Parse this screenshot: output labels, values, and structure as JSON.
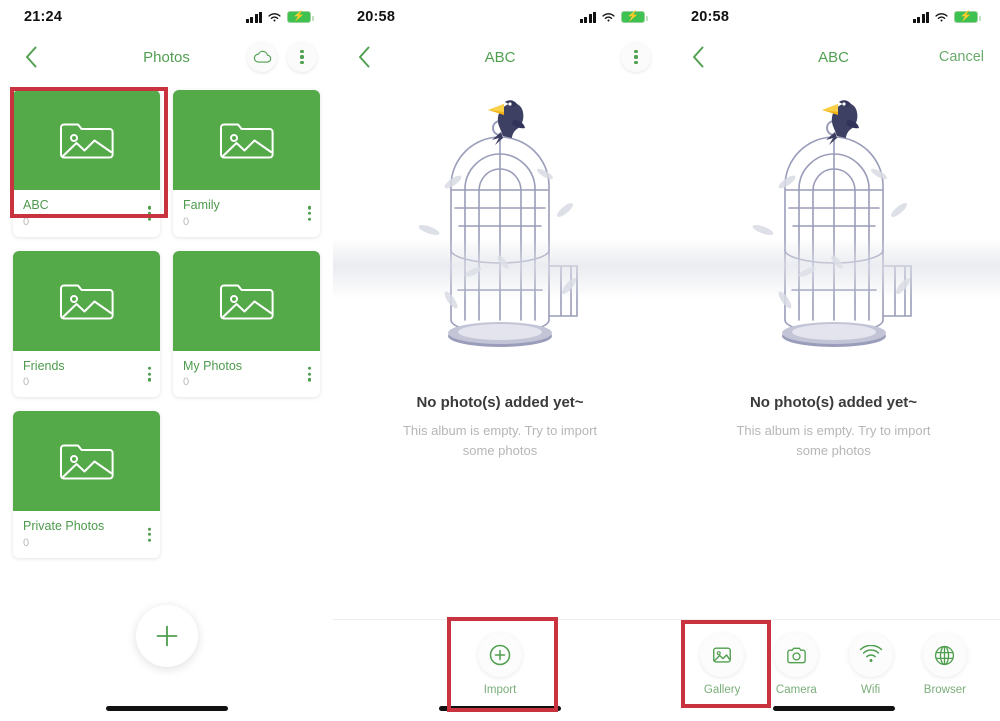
{
  "colors": {
    "green_accent": "#52a052",
    "card_green": "#54a948",
    "annotation_red": "#c9323f",
    "muted_text": "#b6b6b6"
  },
  "panel1": {
    "status": {
      "time": "21:24",
      "signal_icon": "signal-bars-icon",
      "wifi_icon": "wifi-icon",
      "battery_icon": "battery-charging-icon"
    },
    "nav": {
      "back_icon": "chevron-left-icon",
      "title": "Photos",
      "cloud_icon": "cloud-icon",
      "menu_icon": "more-vertical-icon"
    },
    "albums": [
      {
        "name": "ABC",
        "count": "0",
        "thumb_icon": "photo-folder-icon",
        "menu_icon": "more-vertical-icon"
      },
      {
        "name": "Family",
        "count": "0",
        "thumb_icon": "photo-folder-icon",
        "menu_icon": "more-vertical-icon"
      },
      {
        "name": "Friends",
        "count": "0",
        "thumb_icon": "photo-folder-icon",
        "menu_icon": "more-vertical-icon"
      },
      {
        "name": "My Photos",
        "count": "0",
        "thumb_icon": "photo-folder-icon",
        "menu_icon": "more-vertical-icon"
      },
      {
        "name": "Private Photos",
        "count": "0",
        "thumb_icon": "photo-folder-icon",
        "menu_icon": "more-vertical-icon"
      }
    ],
    "fab": {
      "icon": "plus-icon",
      "label": "Add album"
    },
    "annotation": "highlight around ABC album card"
  },
  "panel2": {
    "status": {
      "time": "20:58",
      "signal_icon": "signal-bars-icon",
      "wifi_icon": "wifi-icon",
      "battery_icon": "battery-charging-icon"
    },
    "nav": {
      "back_icon": "chevron-left-icon",
      "title": "ABC",
      "menu_icon": "more-vertical-icon"
    },
    "empty": {
      "illustration": "birdcage-with-bird-illustration",
      "title": "No photo(s) added yet~",
      "subtitle": "This album is empty. Try to import some photos"
    },
    "bottom_actions": [
      {
        "label": "Import",
        "icon": "plus-circle-icon"
      }
    ],
    "annotation": "highlight around Import button"
  },
  "panel3": {
    "status": {
      "time": "20:58",
      "signal_icon": "signal-bars-icon",
      "wifi_icon": "wifi-icon",
      "battery_icon": "battery-charging-icon"
    },
    "nav": {
      "back_icon": "chevron-left-icon",
      "title": "ABC",
      "cancel_label": "Cancel"
    },
    "empty": {
      "illustration": "birdcage-with-bird-illustration",
      "title": "No photo(s) added yet~",
      "subtitle": "This album is empty. Try to import some photos"
    },
    "bottom_actions": [
      {
        "label": "Gallery",
        "icon": "gallery-icon"
      },
      {
        "label": "Camera",
        "icon": "camera-icon"
      },
      {
        "label": "Wifi",
        "icon": "wifi-icon"
      },
      {
        "label": "Browser",
        "icon": "globe-icon"
      }
    ],
    "annotation": "highlight around Gallery button"
  }
}
